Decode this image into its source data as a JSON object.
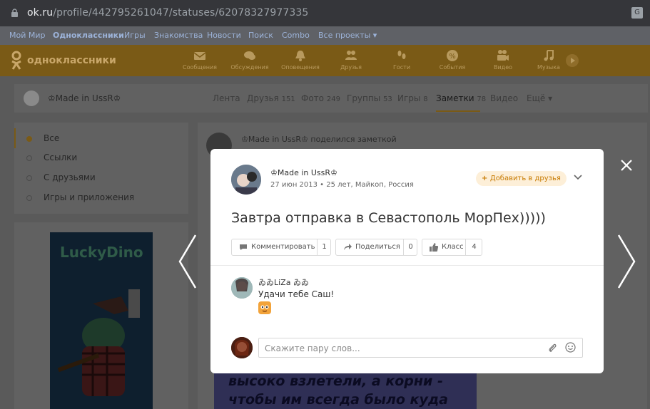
{
  "browser": {
    "url_host": "ok.ru",
    "url_path": "/profile/442795261047/statuses/62078327977335"
  },
  "portal_nav": [
    "Мой Мир",
    "Одноклассники",
    "Игры",
    "Знакомства",
    "Новости",
    "Поиск",
    "Combo",
    "Все проекты ▾"
  ],
  "site": {
    "logo_text": "одноклассники",
    "toolbar": [
      {
        "icon": "envelope-icon",
        "label": "Сообщения"
      },
      {
        "icon": "chat-icon",
        "label": "Обсуждения"
      },
      {
        "icon": "bell-icon",
        "label": "Оповещения"
      },
      {
        "icon": "friends-icon",
        "label": "Друзья"
      },
      {
        "icon": "footprints-icon",
        "label": "Гости"
      },
      {
        "icon": "events-icon",
        "label": "События"
      },
      {
        "icon": "video-camera-icon",
        "label": "Видео"
      },
      {
        "icon": "music-note-icon",
        "label": "Музыка"
      }
    ]
  },
  "profile": {
    "name": "♔Made in UssR♔",
    "tabs": [
      {
        "label": "Лента",
        "count": ""
      },
      {
        "label": "Друзья",
        "count": "151"
      },
      {
        "label": "Фото",
        "count": "249"
      },
      {
        "label": "Группы",
        "count": "53"
      },
      {
        "label": "Игры",
        "count": "8"
      },
      {
        "label": "Заметки",
        "count": "78"
      },
      {
        "label": "Видео",
        "count": ""
      },
      {
        "label": "Ещё ▾",
        "count": ""
      }
    ]
  },
  "left_menu": [
    "Все",
    "Ссылки",
    "С друзьями",
    "Игры и приложения"
  ],
  "ad": {
    "title": "LuckyDino"
  },
  "feed": {
    "header": "♔Made in UssR♔ поделился заметкой",
    "image_lines": [
      "высоко взлетели, а корни -",
      "чтобы им всегда было куда"
    ]
  },
  "modal": {
    "author": "♔Made in UssR♔",
    "meta": "27 июн 2013 • 25 лет, Майкоп, Россия",
    "add_friend": "Добавить в друзья",
    "text": "Завтра отправка в Севастополь МорПех)))))",
    "actions": [
      {
        "label": "Комментировать",
        "count": "1"
      },
      {
        "label": "Поделиться",
        "count": "0"
      },
      {
        "label": "Класс",
        "count": "4"
      }
    ],
    "comment": {
      "author": "ゐゐLiZa ゐゐ",
      "text": "Удачи тебе Саш!"
    },
    "input_placeholder": "Скажите пару слов..."
  }
}
